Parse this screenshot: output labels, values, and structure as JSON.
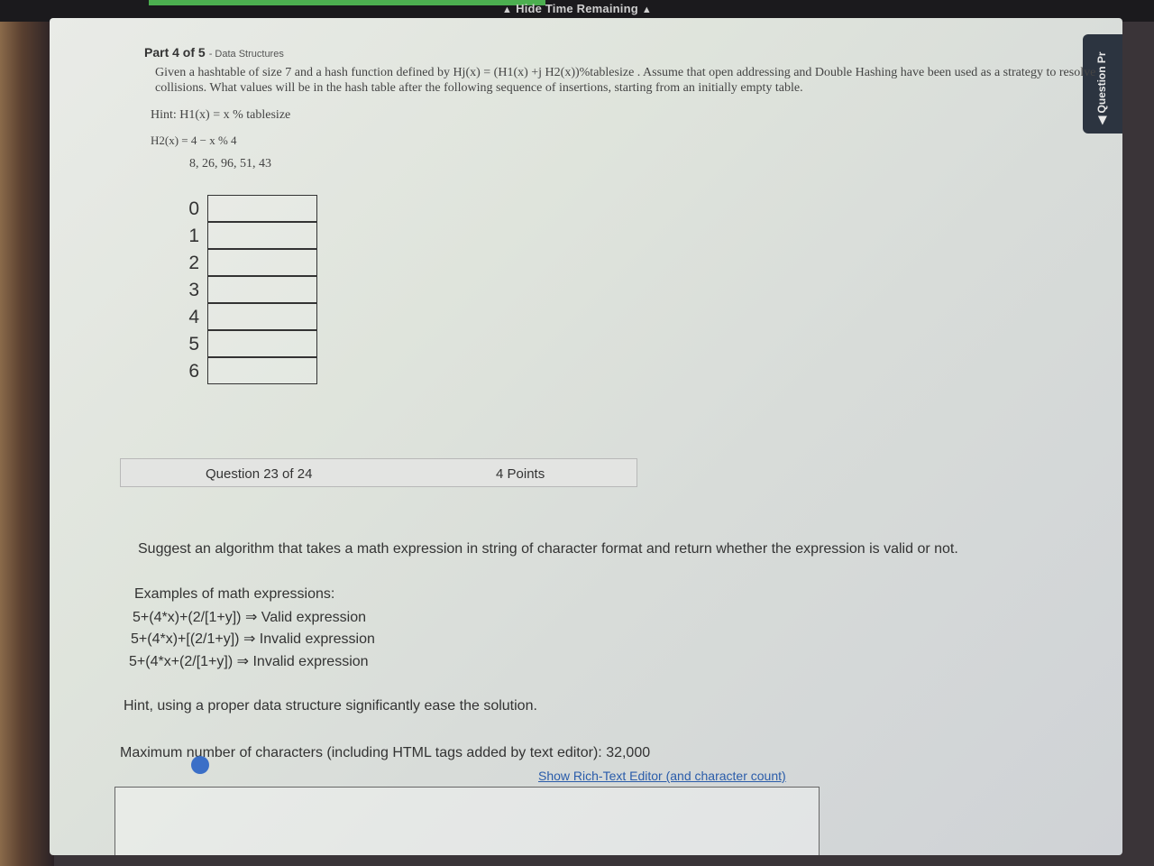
{
  "topbar": {
    "timer_label": "Hide Time Remaining"
  },
  "side_tab": {
    "label": "Question Pr"
  },
  "part": {
    "title": "Part 4 of 5",
    "subtitle": "- Data Structures",
    "problem": "Given a hashtable of size 7 and a hash function defined by Hj(x) = (H1(x) +j H2(x))%tablesize . Assume that open addressing and Double Hashing have been used as a strategy to resolve collisions. What values will be in the hash table after the following sequence of insertions, starting from an initially empty table.",
    "hint_h1": "Hint:  H1(x) = x % tablesize",
    "hint_h2": "H2(x) = 4 − x % 4",
    "sequence": "8, 26, 96, 51, 43",
    "table_indices": [
      "0",
      "1",
      "2",
      "3",
      "4",
      "5",
      "6"
    ]
  },
  "question_bar": {
    "number": "Question 23 of 24",
    "points": "4 Points"
  },
  "question": {
    "text": "Suggest an algorithm that takes a math expression in string of character format and return whether the expression is valid or not.",
    "examples_title": "Examples of math expressions:",
    "examples": [
      "5+(4*x)+(2/[1+y]) ⇒ Valid expression",
      "5+(4*x)+[(2/1+y]) ⇒ Invalid expression",
      "5+(4*x+(2/[1+y]) ⇒ Invalid expression"
    ],
    "hint": "Hint, using a proper data structure significantly ease the solution.",
    "max_chars": "Maximum number of characters (including HTML tags added by text editor): 32,000",
    "rich_text_link": "Show Rich-Text Editor (and character count)"
  }
}
